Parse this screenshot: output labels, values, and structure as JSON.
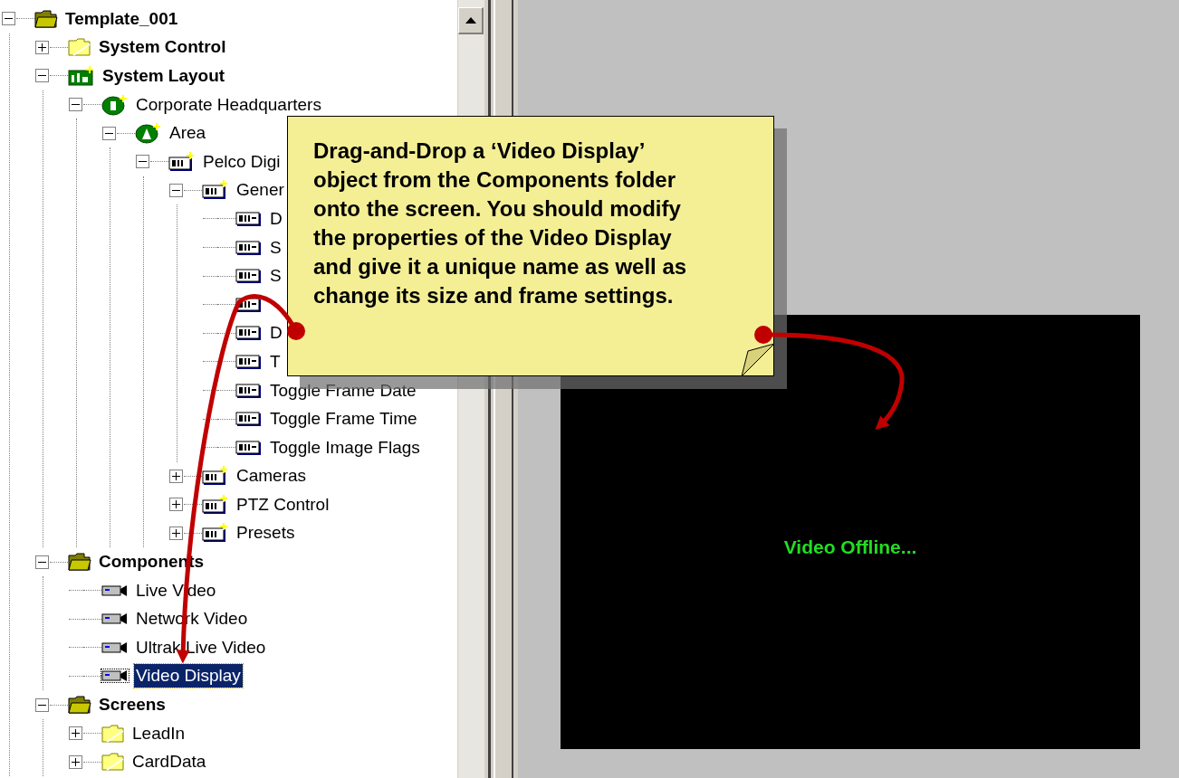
{
  "tree": {
    "label": "Template_001",
    "kind": "folder-open",
    "expanded": true,
    "selected": false,
    "children": [
      {
        "label": "System Control",
        "kind": "folder",
        "expanded": false,
        "selected": false
      },
      {
        "label": "System Layout",
        "kind": "layout",
        "expanded": true,
        "selected": false,
        "children": [
          {
            "label": "Corporate Headquarters",
            "kind": "site",
            "expanded": true,
            "selected": false,
            "children": [
              {
                "label": "Area",
                "kind": "area",
                "expanded": true,
                "selected": false,
                "children": [
                  {
                    "label": "Pelco Digi",
                    "kind": "group",
                    "expanded": true,
                    "selected": false,
                    "children": [
                      {
                        "label": "Gener",
                        "kind": "group",
                        "expanded": true,
                        "selected": false,
                        "children": [
                          {
                            "label": "D",
                            "kind": "object",
                            "selected": false
                          },
                          {
                            "label": "S",
                            "kind": "object",
                            "selected": false
                          },
                          {
                            "label": "S",
                            "kind": "object",
                            "selected": false
                          },
                          {
                            "kind": "object",
                            "selected": false
                          },
                          {
                            "label": "D",
                            "kind": "object",
                            "selected": false
                          },
                          {
                            "label": "T",
                            "kind": "object",
                            "selected": false
                          },
                          {
                            "label": "Toggle Frame Date",
                            "kind": "object",
                            "selected": false
                          },
                          {
                            "label": "Toggle Frame Time",
                            "kind": "object",
                            "selected": false
                          },
                          {
                            "label": "Toggle Image Flags",
                            "kind": "object",
                            "selected": false
                          }
                        ]
                      },
                      {
                        "label": "Cameras",
                        "kind": "group",
                        "expanded": false,
                        "selected": false
                      },
                      {
                        "label": "PTZ Control",
                        "kind": "group",
                        "expanded": false,
                        "selected": false
                      },
                      {
                        "label": "Presets",
                        "kind": "group",
                        "expanded": false,
                        "selected": false
                      }
                    ]
                  }
                ]
              }
            ]
          }
        ]
      },
      {
        "label": "Components",
        "kind": "folder-open",
        "expanded": true,
        "selected": false,
        "children": [
          {
            "label": "Live Video",
            "kind": "camera",
            "selected": false
          },
          {
            "label": "Network Video",
            "kind": "camera",
            "selected": false
          },
          {
            "label": "Ultrak Live Video",
            "kind": "camera",
            "selected": false
          },
          {
            "label": "Video Display",
            "kind": "camera",
            "selected": true
          }
        ]
      },
      {
        "label": "Screens",
        "kind": "folder-open",
        "expanded": true,
        "selected": false,
        "children": [
          {
            "label": "LeadIn",
            "kind": "folder",
            "expanded": false,
            "selected": false
          },
          {
            "label": "CardData",
            "kind": "folder",
            "expanded": false,
            "selected": false
          }
        ]
      }
    ]
  },
  "video_display": {
    "status": "Video Offline..."
  },
  "callout": {
    "text": "Drag-and-Drop a ‘Video Display’ object from the Components folder onto the screen. You should modify the properties of the Video Display and give it a unique name as well as change its size and frame settings."
  }
}
